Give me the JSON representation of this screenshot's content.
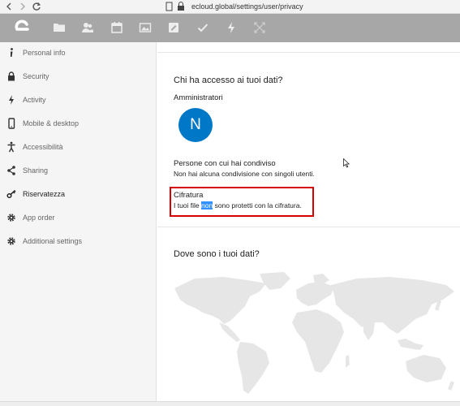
{
  "browser": {
    "url": "ecloud.global/settings/user/privacy",
    "back_icon": "back-arrow-icon",
    "forward_icon": "forward-arrow-icon",
    "reload_icon": "reload-icon"
  },
  "header": {
    "logo": "e-logo-icon",
    "nav_icons": [
      "files-icon",
      "contacts-icon",
      "calendar-icon",
      "photos-icon",
      "notes-icon",
      "tasks-icon",
      "activity-icon",
      "fullscreen-icon"
    ]
  },
  "sidebar": {
    "items": [
      {
        "label": "Personal info",
        "icon": "info-icon"
      },
      {
        "label": "Security",
        "icon": "lock-icon"
      },
      {
        "label": "Activity",
        "icon": "bolt-icon"
      },
      {
        "label": "Mobile & desktop",
        "icon": "phone-icon"
      },
      {
        "label": "Accessibilità",
        "icon": "accessibility-icon"
      },
      {
        "label": "Sharing",
        "icon": "share-icon"
      },
      {
        "label": "Riservatezza",
        "icon": "key-icon"
      },
      {
        "label": "App order",
        "icon": "gear-icon"
      },
      {
        "label": "Additional settings",
        "icon": "gear-icon"
      }
    ],
    "active_index": 6
  },
  "privacy": {
    "access_title": "Chi ha accesso ai tuoi dati?",
    "admins_label": "Amministratori",
    "admin_avatar_letter": "N",
    "shared_title": "Persone con cui hai condiviso",
    "shared_text": "Non hai alcuna condivisione con singoli utenti.",
    "encryption_title": "Cifratura",
    "encryption_before": "I tuoi file ",
    "encryption_selected": "non",
    "encryption_after": " sono protetti con la cifratura.",
    "location_title": "Dove sono i tuoi dati?"
  },
  "colors": {
    "header_bg": "#a7a7a7",
    "avatar_bg": "#0078c8",
    "highlight_border": "#d60000",
    "selection": "#3390ff"
  }
}
